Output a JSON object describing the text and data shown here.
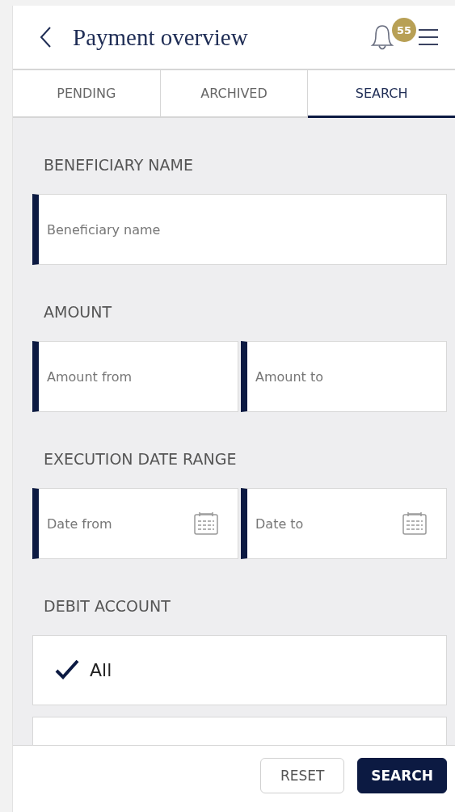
{
  "header": {
    "title": "Payment overview",
    "notification_count": "55"
  },
  "tabs": [
    {
      "label": "PENDING",
      "selected": false
    },
    {
      "label": "ARCHIVED",
      "selected": false
    },
    {
      "label": "SEARCH",
      "selected": true
    }
  ],
  "sections": [
    {
      "label": "BENEFICIARY NAME",
      "fields": [
        {
          "placeholder": "Beneficiary name",
          "kind": "text"
        }
      ]
    },
    {
      "label": "AMOUNT",
      "fields": [
        {
          "placeholder": "Amount from",
          "kind": "text"
        },
        {
          "placeholder": "Amount to",
          "kind": "text"
        }
      ]
    },
    {
      "label": "EXECUTION DATE RANGE",
      "fields": [
        {
          "placeholder": "Date from",
          "kind": "date"
        },
        {
          "placeholder": "Date to",
          "kind": "date"
        }
      ]
    }
  ],
  "debit_account": {
    "label": "DEBIT ACCOUNT",
    "options": [
      {
        "label": "All",
        "selected": true
      },
      {
        "selected": false
      }
    ]
  },
  "buttons": [
    {
      "label": "RESET",
      "kind": "secondary"
    },
    {
      "label": "SEARCH",
      "kind": "primary"
    }
  ]
}
